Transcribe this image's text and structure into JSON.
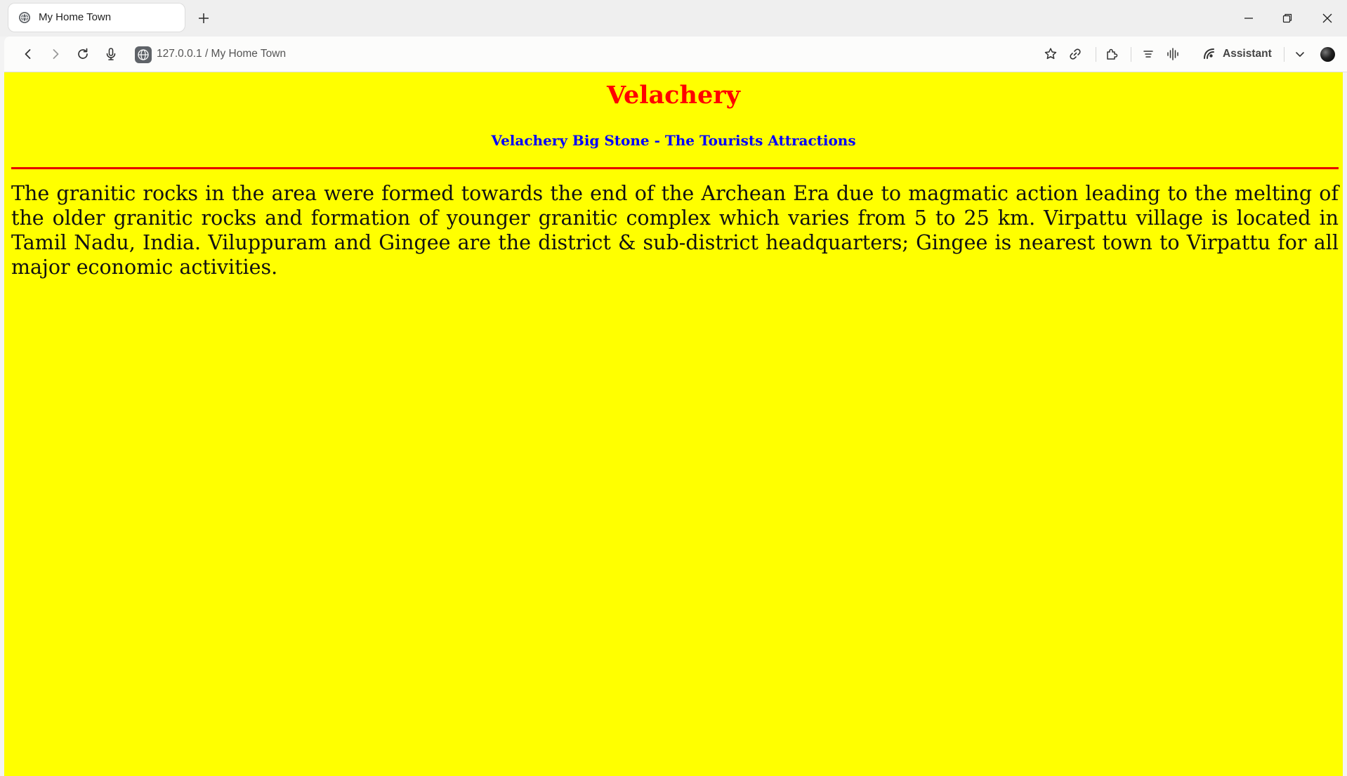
{
  "browser": {
    "tab_title": "My Home Town",
    "new_tab_symbol": "+",
    "address_text": "127.0.0.1 / My Home Town",
    "assistant_label": "Assistant",
    "icons": {
      "tab_favicon": "globe-icon",
      "new_tab": "plus-icon",
      "minimize": "minimize-icon",
      "maximize": "restore-icon",
      "close": "close-icon",
      "back": "back-arrow-icon",
      "forward": "forward-arrow-icon",
      "reload": "reload-icon",
      "voice": "microphone-icon",
      "site_info": "globe-icon",
      "bookmark": "star-icon",
      "share_link": "link-icon",
      "extensions": "puzzle-icon",
      "reading_list": "list-icon",
      "audio": "audio-wave-icon",
      "assistant": "assistant-icon",
      "menu": "chevron-down-icon",
      "profile": "profile-avatar"
    }
  },
  "page": {
    "heading": "Velachery",
    "subheading": "Velachery Big Stone - The Tourists Attractions",
    "paragraph": "The granitic rocks in the area were formed towards the end of the Archean Era due to magmatic action leading to the melting of the older granitic rocks and formation of younger granitic complex which varies from 5 to 25 km. Virpattu village is located in Tamil Nadu, India. Viluppuram and Gingee are the district & sub-district headquarters; Gingee is nearest town to Virpattu for all major economic activities.",
    "colors": {
      "background": "#ffff00",
      "heading": "#ff0000",
      "subheading": "#0000ff",
      "rule": "#e60000"
    }
  }
}
